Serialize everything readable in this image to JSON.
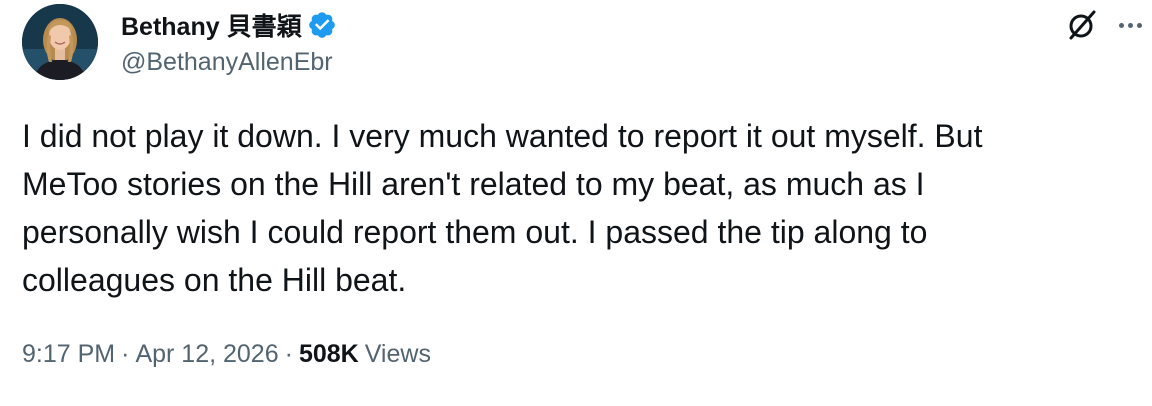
{
  "author": {
    "display_name": "Bethany 貝書穎",
    "handle": "@BethanyAllenEbr",
    "verified": true,
    "verified_color": "#1d9bf0"
  },
  "tweet": {
    "lines": [
      "I did not play it down. I very much wanted to report it out myself. But",
      "MeToo stories on the Hill aren't related to my beat, as much as I",
      "personally wish I could report them out. I passed the tip along to",
      "colleagues on the Hill beat."
    ]
  },
  "meta": {
    "time": "9:17 PM",
    "separator": "·",
    "date": "Apr 12, 2026",
    "views_count": "508K",
    "views_label": "Views"
  },
  "icons": {
    "grok": "grok-icon",
    "more": "more-icon",
    "verified": "verified-badge-icon"
  }
}
